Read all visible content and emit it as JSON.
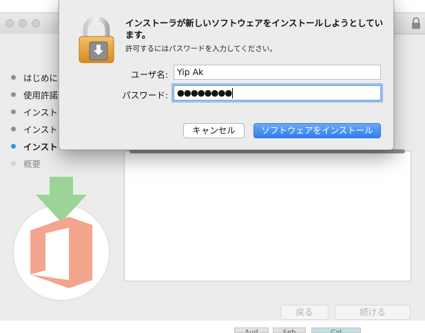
{
  "dialog": {
    "title": "インストーラが新しいソフトウェアをインストールしようとしています。",
    "message": "許可するにはパスワードを入力してください。",
    "username_label": "ユーザ名:",
    "username_value": "Yip Ak",
    "password_label": "パスワード:",
    "password_mask": "●●●●●●●●",
    "cancel_label": "キャンセル",
    "install_label": "ソフトウェアをインストール",
    "accent_color": "#3b82f1"
  },
  "installer": {
    "steps": [
      {
        "label": "はじめに",
        "state": "done"
      },
      {
        "label": "使用許諾契約",
        "state": "done"
      },
      {
        "label": "インストール先",
        "state": "done"
      },
      {
        "label": "インストールの種類",
        "state": "done"
      },
      {
        "label": "インストール",
        "state": "current"
      },
      {
        "label": "概要",
        "state": "future"
      }
    ],
    "back_label": "戻る",
    "continue_label": "続ける",
    "bottom_tabs": [
      "Aud",
      "Seb",
      "Cal"
    ],
    "icons": {
      "lock": "lock-icon",
      "office": "office-logo-icon",
      "download_arrow": "download-arrow-icon"
    }
  }
}
